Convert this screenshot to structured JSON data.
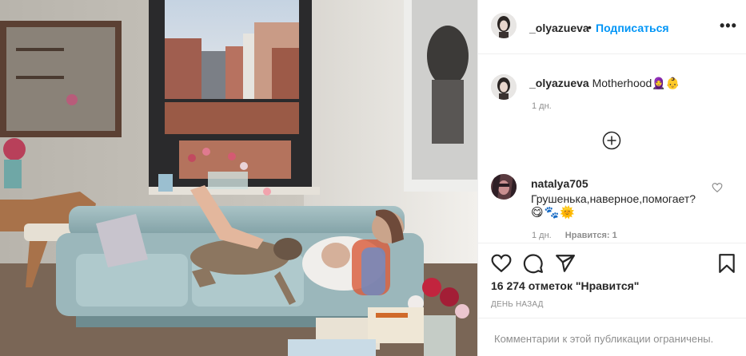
{
  "post": {
    "username": "_olyazueva",
    "separator": "•",
    "follow_label": "Подписаться",
    "more_label": "•••",
    "caption_text": "Motherhood",
    "caption_emoji": "🧕👶",
    "caption_time": "1 дн.",
    "likes_text": "16 274 отметок \"Нравится\"",
    "posted_text": "ДЕНЬ НАЗАД",
    "comments_disabled": "Комментарии к этой публикации ограничены."
  },
  "comment": {
    "username": "natalya705",
    "text": "Грушенька,наверное,помогает?",
    "emoji": [
      "😋",
      "🐾",
      "🌞"
    ],
    "time": "1 дн.",
    "likes": "Нравится: 1"
  },
  "icons": {
    "like": "heart-icon",
    "comment": "comment-icon",
    "share": "share-icon",
    "save": "bookmark-icon",
    "load_more": "plus-circle-icon",
    "more": "more-icon"
  },
  "colors": {
    "accent": "#0095f6",
    "muted": "#8e8e8e",
    "text": "#262626",
    "border": "#efefef"
  }
}
